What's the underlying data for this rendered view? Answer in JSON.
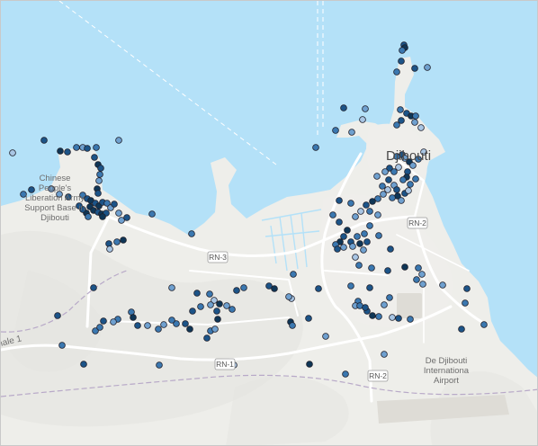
{
  "map": {
    "colors": {
      "water": "#b4e1f8",
      "land": "#eeeeea",
      "terrain": "#e4e4df",
      "urban": "#efeeeb",
      "road": "#ffffff",
      "airport": "#dedcd6",
      "border": "#b8a9c8",
      "maritime": "#ffffff"
    },
    "point_palette": [
      "#d7dbf2",
      "#a9c6e4",
      "#6fa0cf",
      "#3b78b0",
      "#1c5488",
      "#0f3656"
    ],
    "labels": {
      "city": "Djibouti",
      "base_line1": "Chinese",
      "base_line2": "People's",
      "base_line3": "Liberation Army",
      "base_line4": "Support Base in",
      "base_line5": "Djibouti",
      "airport_line1": "De Djibouti",
      "airport_line2": "Internationa",
      "airport_line3": "Airport",
      "admin": "nale 1"
    },
    "road_shields": [
      "RN-2",
      "RN-3",
      "RN-1",
      "RN-2"
    ],
    "points": [
      [
        448,
        49,
        4
      ],
      [
        449,
        52,
        5
      ],
      [
        446,
        55,
        3
      ],
      [
        445,
        67,
        4
      ],
      [
        460,
        75,
        4
      ],
      [
        440,
        79,
        3
      ],
      [
        474,
        74,
        2
      ],
      [
        381,
        119,
        4
      ],
      [
        405,
        120,
        2
      ],
      [
        444,
        121,
        3
      ],
      [
        451,
        125,
        4
      ],
      [
        456,
        128,
        5
      ],
      [
        461,
        128,
        3
      ],
      [
        445,
        133,
        4
      ],
      [
        402,
        132,
        1
      ],
      [
        440,
        138,
        3
      ],
      [
        460,
        135,
        2
      ],
      [
        372,
        144,
        3
      ],
      [
        390,
        146,
        2
      ],
      [
        467,
        141,
        1
      ],
      [
        48,
        155,
        4
      ],
      [
        66,
        167,
        5
      ],
      [
        74,
        168,
        4
      ],
      [
        84,
        163,
        3
      ],
      [
        91,
        163,
        2
      ],
      [
        96,
        164,
        4
      ],
      [
        106,
        163,
        3
      ],
      [
        131,
        155,
        2
      ],
      [
        13,
        169,
        1
      ],
      [
        350,
        163,
        3
      ],
      [
        104,
        174,
        4
      ],
      [
        108,
        182,
        5
      ],
      [
        111,
        186,
        4
      ],
      [
        110,
        193,
        3
      ],
      [
        109,
        200,
        2
      ],
      [
        107,
        209,
        5
      ],
      [
        108,
        214,
        4
      ],
      [
        440,
        173,
        3
      ],
      [
        446,
        171,
        4
      ],
      [
        449,
        175,
        2
      ],
      [
        454,
        179,
        5
      ],
      [
        442,
        185,
        1
      ],
      [
        452,
        190,
        4
      ],
      [
        458,
        183,
        2
      ],
      [
        464,
        176,
        3
      ],
      [
        470,
        168,
        1
      ],
      [
        432,
        186,
        4
      ],
      [
        437,
        190,
        3
      ],
      [
        451,
        196,
        5
      ],
      [
        447,
        199,
        3
      ],
      [
        431,
        199,
        4
      ],
      [
        424,
        206,
        3
      ],
      [
        437,
        205,
        2
      ],
      [
        440,
        210,
        4
      ],
      [
        455,
        204,
        3
      ],
      [
        449,
        214,
        4
      ],
      [
        441,
        217,
        5
      ],
      [
        430,
        210,
        1
      ],
      [
        425,
        215,
        2
      ],
      [
        461,
        198,
        3
      ],
      [
        445,
        222,
        2
      ],
      [
        435,
        219,
        3
      ],
      [
        453,
        211,
        1
      ],
      [
        419,
        220,
        3
      ],
      [
        413,
        223,
        5
      ],
      [
        406,
        227,
        4
      ],
      [
        410,
        234,
        3
      ],
      [
        419,
        238,
        2
      ],
      [
        400,
        234,
        1
      ],
      [
        410,
        250,
        3
      ],
      [
        420,
        261,
        3
      ],
      [
        418,
        195,
        2
      ],
      [
        427,
        190,
        2
      ],
      [
        91,
        216,
        3
      ],
      [
        96,
        220,
        4
      ],
      [
        100,
        222,
        5
      ],
      [
        105,
        225,
        4
      ],
      [
        109,
        228,
        5
      ],
      [
        113,
        224,
        4
      ],
      [
        118,
        225,
        3
      ],
      [
        122,
        230,
        2
      ],
      [
        126,
        226,
        4
      ],
      [
        99,
        229,
        5
      ],
      [
        103,
        233,
        5
      ],
      [
        108,
        235,
        4
      ],
      [
        112,
        237,
        5
      ],
      [
        117,
        236,
        4
      ],
      [
        113,
        240,
        5
      ],
      [
        95,
        236,
        5
      ],
      [
        91,
        232,
        4
      ],
      [
        97,
        240,
        3
      ],
      [
        87,
        228,
        4
      ],
      [
        131,
        236,
        2
      ],
      [
        140,
        241,
        4
      ],
      [
        56,
        209,
        2
      ],
      [
        34,
        210,
        4
      ],
      [
        25,
        215,
        3
      ],
      [
        65,
        215,
        2
      ],
      [
        75,
        218,
        4
      ],
      [
        168,
        237,
        3
      ],
      [
        134,
        244,
        2
      ],
      [
        369,
        238,
        3
      ],
      [
        389,
        225,
        3
      ],
      [
        376,
        222,
        4
      ],
      [
        394,
        240,
        2
      ],
      [
        376,
        246,
        4
      ],
      [
        385,
        255,
        5
      ],
      [
        381,
        262,
        4
      ],
      [
        377,
        268,
        5
      ],
      [
        372,
        271,
        3
      ],
      [
        389,
        268,
        4
      ],
      [
        396,
        262,
        3
      ],
      [
        391,
        273,
        2
      ],
      [
        399,
        270,
        5
      ],
      [
        407,
        268,
        4
      ],
      [
        404,
        259,
        3
      ],
      [
        403,
        277,
        2
      ],
      [
        394,
        285,
        1
      ],
      [
        398,
        294,
        3
      ],
      [
        374,
        276,
        4
      ],
      [
        381,
        274,
        2
      ],
      [
        212,
        259,
        3
      ],
      [
        120,
        270,
        4
      ],
      [
        129,
        268,
        3
      ],
      [
        136,
        266,
        5
      ],
      [
        121,
        276,
        1
      ],
      [
        433,
        276,
        4
      ],
      [
        412,
        297,
        3
      ],
      [
        389,
        317,
        3
      ],
      [
        430,
        300,
        4
      ],
      [
        449,
        296,
        5
      ],
      [
        464,
        297,
        3
      ],
      [
        468,
        304,
        2
      ],
      [
        462,
        310,
        3
      ],
      [
        469,
        315,
        2
      ],
      [
        432,
        330,
        3
      ],
      [
        410,
        319,
        4
      ],
      [
        397,
        334,
        3
      ],
      [
        394,
        339,
        2
      ],
      [
        407,
        345,
        4
      ],
      [
        413,
        350,
        5
      ],
      [
        420,
        351,
        3
      ],
      [
        426,
        338,
        2
      ],
      [
        435,
        352,
        1
      ],
      [
        455,
        354,
        3
      ],
      [
        442,
        353,
        4
      ],
      [
        491,
        316,
        2
      ],
      [
        518,
        320,
        4
      ],
      [
        516,
        336,
        3
      ],
      [
        325,
        304,
        3
      ],
      [
        353,
        320,
        4
      ],
      [
        323,
        331,
        1
      ],
      [
        399,
        339,
        3
      ],
      [
        405,
        341,
        4
      ],
      [
        103,
        319,
        4
      ],
      [
        105,
        367,
        3
      ],
      [
        190,
        319,
        2
      ],
      [
        218,
        325,
        4
      ],
      [
        232,
        326,
        3
      ],
      [
        237,
        333,
        1
      ],
      [
        243,
        337,
        5
      ],
      [
        262,
        322,
        4
      ],
      [
        270,
        319,
        3
      ],
      [
        298,
        317,
        4
      ],
      [
        304,
        320,
        5
      ],
      [
        320,
        329,
        2
      ],
      [
        213,
        345,
        4
      ],
      [
        222,
        340,
        3
      ],
      [
        233,
        338,
        2
      ],
      [
        240,
        345,
        4
      ],
      [
        241,
        354,
        5
      ],
      [
        257,
        343,
        3
      ],
      [
        251,
        339,
        2
      ],
      [
        195,
        359,
        3
      ],
      [
        205,
        359,
        4
      ],
      [
        210,
        365,
        5
      ],
      [
        190,
        355,
        3
      ],
      [
        181,
        360,
        2
      ],
      [
        175,
        365,
        3
      ],
      [
        163,
        361,
        2
      ],
      [
        152,
        361,
        4
      ],
      [
        145,
        346,
        3
      ],
      [
        147,
        352,
        5
      ],
      [
        130,
        354,
        3
      ],
      [
        125,
        357,
        2
      ],
      [
        114,
        356,
        4
      ],
      [
        110,
        363,
        3
      ],
      [
        229,
        375,
        4
      ],
      [
        233,
        367,
        3
      ],
      [
        238,
        365,
        2
      ],
      [
        322,
        357,
        5
      ],
      [
        324,
        361,
        3
      ],
      [
        342,
        353,
        4
      ],
      [
        361,
        373,
        2
      ],
      [
        63,
        350,
        4
      ],
      [
        68,
        383,
        3
      ],
      [
        92,
        404,
        4
      ],
      [
        176,
        405,
        3
      ],
      [
        259,
        405,
        1
      ],
      [
        343,
        404,
        5
      ],
      [
        383,
        415,
        3
      ],
      [
        426,
        393,
        2
      ],
      [
        512,
        365,
        4
      ],
      [
        537,
        360,
        3
      ]
    ]
  }
}
